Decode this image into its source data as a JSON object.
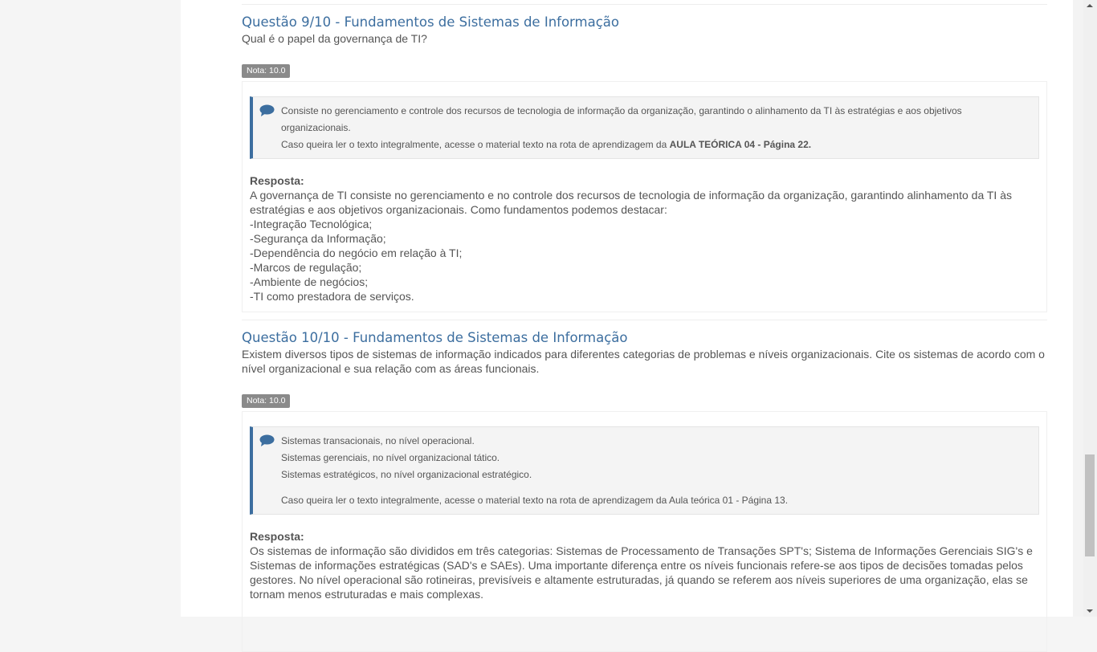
{
  "questions": [
    {
      "title": "Questão 9/10 - Fundamentos de Sistemas de Informação",
      "question": "Qual é o papel da governança de TI?",
      "grade": "Nota: 10.0",
      "feedback": {
        "line1": "Consiste no gerenciamento e controle dos recursos de tecnologia de informação da organização, garantindo o alinhamento da TI às estratégias e aos objetivos organizacionais.",
        "ref_prefix": "Caso queira ler o texto integralmente, acesse o material texto na rota de aprendizagem da ",
        "ref_bold": "AULA TEÓRICA 04 - Página 22."
      },
      "answer_label": "Resposta:",
      "answer_lines": [
        "A governança de TI consiste no gerenciamento e no controle dos recursos de tecnologia de informação da organização, garantindo alinhamento da TI às estratégias e aos objetivos organizacionais. Como fundamentos podemos destacar:",
        "-Integração Tecnológica;",
        "-Segurança da Informação;",
        "-Dependência do negócio em relação à TI;",
        "-Marcos de regulação;",
        "-Ambiente de negócios;",
        "-TI como prestadora de serviços."
      ]
    },
    {
      "title": "Questão 10/10 - Fundamentos de Sistemas de Informação",
      "question": "Existem diversos tipos de sistemas de informação indicados para diferentes categorias de problemas e níveis organizacionais. Cite os sistemas de acordo com o nível organizacional e sua relação com as áreas funcionais.",
      "grade": "Nota: 10.0",
      "feedback": {
        "lines": [
          "Sistemas transacionais, no nível operacional.",
          "Sistemas gerenciais, no nível organizacional tático.",
          "Sistemas estratégicos, no nível organizacional estratégico."
        ],
        "ref": "Caso queira ler o texto integralmente, acesse o material texto na rota de aprendizagem da Aula teórica 01 - Página 13."
      },
      "answer_label": "Resposta:",
      "answer_text": "Os sistemas de informação são divididos em três categorias: Sistemas de Processamento de Transações SPT's; Sistema de Informações Gerenciais SIG's e Sistemas de informações estratégicas (SAD's e SAEs). Uma importante diferença entre os níveis funcionais refere-se aos tipos de decisões tomadas pelos gestores. No nível operacional são rotineiras, previsíveis e altamente estruturadas, já quando se referem aos níveis superiores de uma organização, elas se tornam menos estruturadas e mais complexas."
    }
  ],
  "colors": {
    "accent": "#3c6e9f",
    "badge": "#8a8a8a"
  }
}
